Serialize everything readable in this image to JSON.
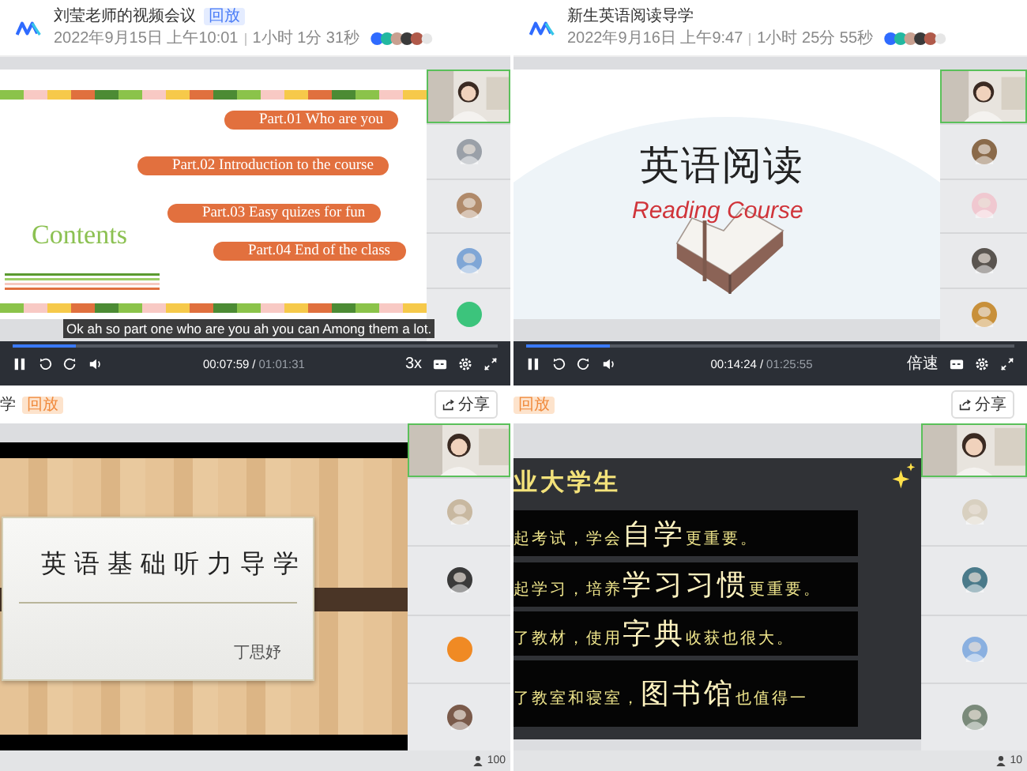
{
  "recordings_top": [
    {
      "title": "刘莹老师的视频会议",
      "badge": "回放",
      "date": "2022年9月15日 上午10:01",
      "duration": "1小时 1分 31秒",
      "slide": {
        "kind": "contents",
        "heading": "Contents",
        "items": [
          "Part.01 Who are you",
          "Part.02 Introduction to the course",
          "Part.03 Easy quizes for fun",
          "Part.04 End of the class"
        ]
      },
      "subtitle": "Ok ah so part one who are you ah you can Among them a lot.",
      "player": {
        "level": 0.13,
        "current": "00:07:59",
        "separator": "/",
        "total": "01:01:31",
        "speed": "3x"
      }
    },
    {
      "title": "新生英语阅读导学",
      "date": "2022年9月16日 上午9:47",
      "duration": "1小时 25分 55秒",
      "slide": {
        "kind": "reading",
        "heading": "英语阅读",
        "subheading": "Reading Course"
      },
      "player": {
        "level": 0.17,
        "current": "00:14:24",
        "separator": "/",
        "total": "01:25:55",
        "speed": "倍速"
      }
    }
  ],
  "recordings_bottom": [
    {
      "title": "学",
      "badge": "回放",
      "share": "分享",
      "slide": {
        "kind": "title_card",
        "heading": "英语基础听力导学",
        "author": "丁思妤"
      },
      "viewers": "100"
    },
    {
      "badge": "回放",
      "share": "分享",
      "slide": {
        "kind": "blackboard",
        "heading": "业大学生",
        "lines": [
          [
            {
              "text": "起考试，学会",
              "big": false
            },
            {
              "text": "自学",
              "big": true
            },
            {
              "text": "更重要。",
              "big": false
            }
          ],
          [
            {
              "text": "起学习，培养",
              "big": false
            },
            {
              "text": "学习习惯",
              "big": true
            },
            {
              "text": "更重要。",
              "big": false
            }
          ],
          [
            {
              "text": "了教材，使用",
              "big": false
            },
            {
              "text": "字典",
              "big": true
            },
            {
              "text": "收获也很大。",
              "big": false
            }
          ],
          [
            {
              "text": "了教室和寝室，",
              "big": false
            },
            {
              "text": "图书馆",
              "big": true
            },
            {
              "text": "也值得一",
              "big": false
            }
          ]
        ]
      },
      "viewers": "10"
    }
  ]
}
